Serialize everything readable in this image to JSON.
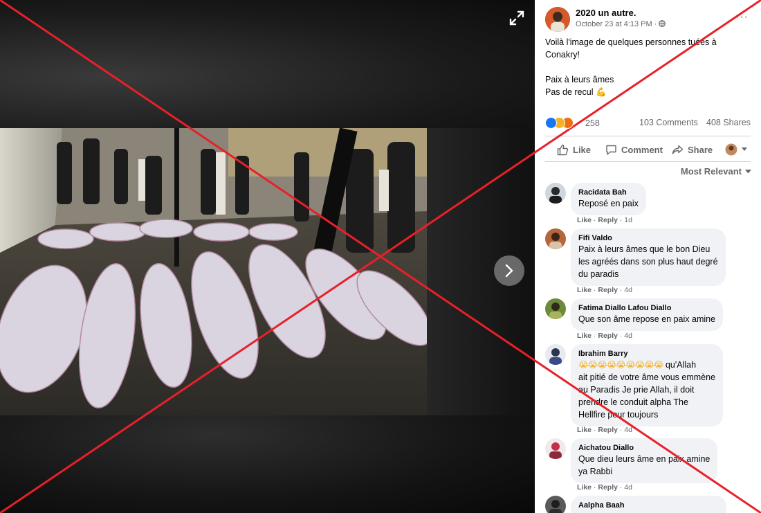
{
  "post": {
    "author": "2020 un autre.",
    "timestamp": "October 23 at 4:13 PM · ",
    "privacy_icon": "globe-icon",
    "text_lines": [
      "Voilà l'image de quelques personnes tuées à",
      "Conakry!"
    ],
    "text_lines_2": [
      "Paix à leurs âmes",
      "Pas de recul"
    ],
    "emoji_end": "flexed-biceps-emoji"
  },
  "stats": {
    "reaction_count": "258",
    "comments": "103 Comments",
    "shares": "408 Shares"
  },
  "actions": {
    "like": "Like",
    "comment": "Comment",
    "share": "Share"
  },
  "sort": {
    "label": "Most Relevant"
  },
  "comments": [
    {
      "name": "Racidata Bah",
      "text": [
        "Reposé en paix"
      ],
      "like": "Like",
      "reply": "Reply",
      "age": "1d"
    },
    {
      "name": "Fifi Valdo",
      "text": [
        "Paix à leurs âmes que le bon Dieu",
        "les agréés dans son plus haut degré",
        "du paradis"
      ],
      "like": "Like",
      "reply": "Reply",
      "age": "4d"
    },
    {
      "name": "Fatima Diallo Lafou Diallo",
      "text": [
        "Que son âme repose en paix amine"
      ],
      "like": "Like",
      "reply": "Reply",
      "age": "4d"
    },
    {
      "name": "Ibrahim Barry",
      "text": [
        "qu'Allah",
        "ait pitié de votre âme vous emmène",
        "au Paradis Je prie Allah, il doit",
        "prendre le conduit alpha The",
        "Hellfire pour toujours"
      ],
      "like": "Like",
      "reply": "Reply",
      "age": "4d"
    },
    {
      "name": "Aichatou Diallo",
      "text": [
        "Que dieu leurs âme en paix amine",
        "ya Rabbi"
      ],
      "like": "Like",
      "reply": "Reply",
      "age": "4d"
    },
    {
      "name": "Aalpha Baah",
      "text": [
        ""
      ],
      "like": "",
      "reply": "",
      "age": ""
    }
  ],
  "colors": {
    "cross": "#e8202a",
    "like_blue": "#1877f2",
    "haha_yellow": "#f7b125",
    "angry_orange": "#e9710f"
  }
}
